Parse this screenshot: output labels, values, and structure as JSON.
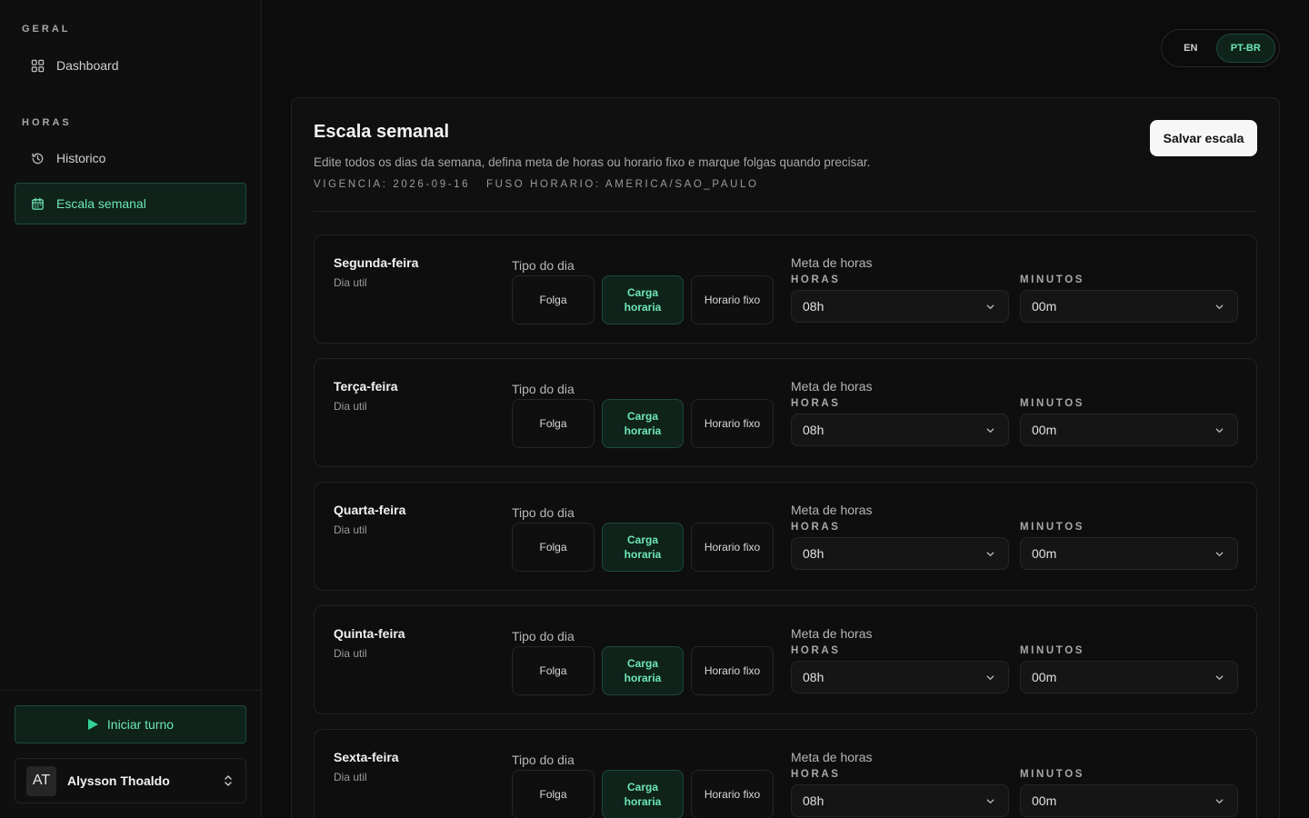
{
  "sidebar": {
    "section_general": "GERAL",
    "dashboard": "Dashboard",
    "section_hours": "HORAS",
    "history": "Historico",
    "weekly": "Escala semanal",
    "start_shift": "Iniciar turno",
    "user": {
      "initials": "AT",
      "name": "Alysson Thoaldo"
    }
  },
  "lang": {
    "en": "EN",
    "pt": "PT-BR",
    "selected": "PT-BR"
  },
  "card": {
    "title": "Escala semanal",
    "subtitle": "Edite todos os dias da semana, defina meta de horas ou horario fixo e marque folgas quando precisar.",
    "vigencia": "VIGENCIA: 2026-09-16",
    "fuso": "FUSO HORARIO: AMERICA/SAO_PAULO",
    "save": "Salvar escala"
  },
  "labels": {
    "tipo": "Tipo do dia",
    "folga": "Folga",
    "carga": "Carga horaria",
    "fixo": "Horario fixo",
    "meta": "Meta de horas",
    "horas": "HORAS",
    "minutos": "MINUTOS"
  },
  "days": [
    {
      "name": "Segunda-feira",
      "sub": "Dia util",
      "selected": "Carga horaria",
      "hours": "08h",
      "minutes": "00m"
    },
    {
      "name": "Terça-feira",
      "sub": "Dia util",
      "selected": "Carga horaria",
      "hours": "08h",
      "minutes": "00m"
    },
    {
      "name": "Quarta-feira",
      "sub": "Dia util",
      "selected": "Carga horaria",
      "hours": "08h",
      "minutes": "00m"
    },
    {
      "name": "Quinta-feira",
      "sub": "Dia util",
      "selected": "Carga horaria",
      "hours": "08h",
      "minutes": "00m"
    },
    {
      "name": "Sexta-feira",
      "sub": "Dia util",
      "selected": "Carga horaria",
      "hours": "08h",
      "minutes": "00m"
    }
  ],
  "colors": {
    "accent": "#6ee7b7",
    "accent_bg": "#0f231b",
    "accent_border": "#1d4a39",
    "background": "#0c0c0c"
  }
}
